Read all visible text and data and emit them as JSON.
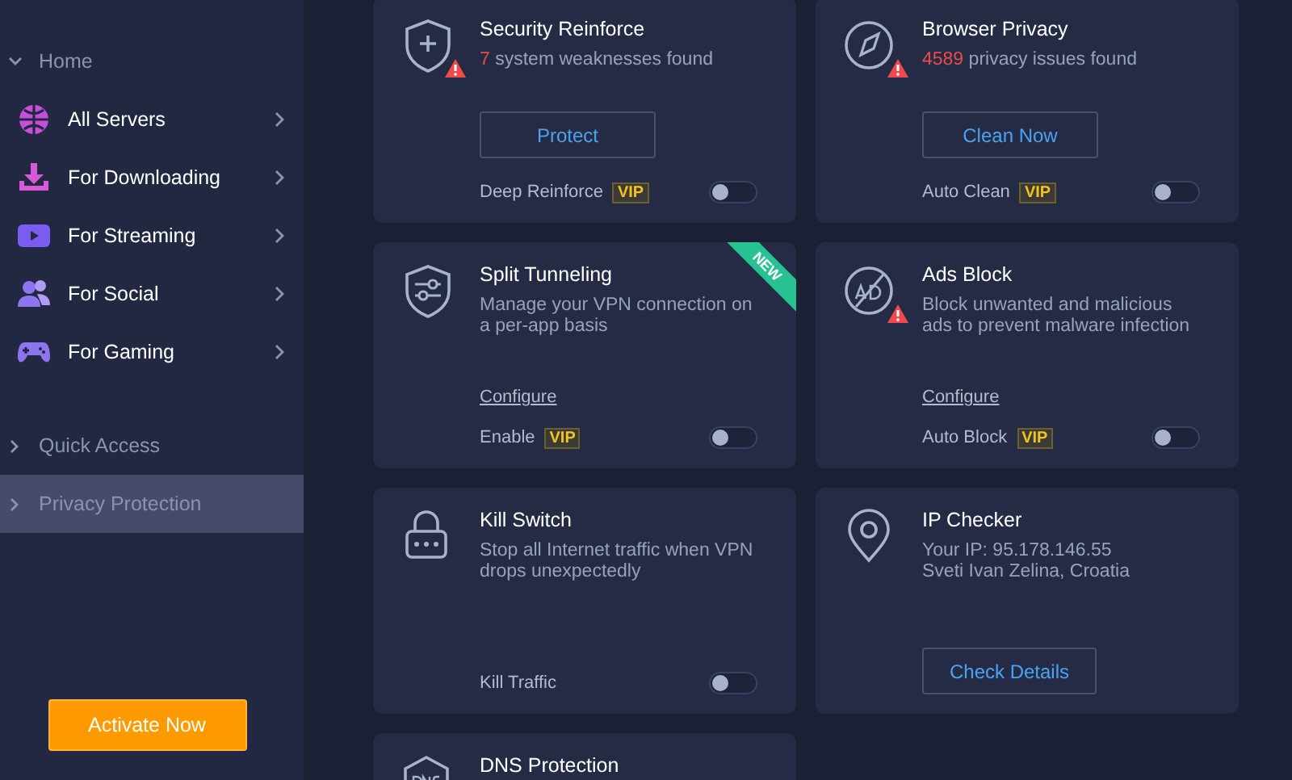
{
  "sidebar": {
    "sections": [
      {
        "label": "Home",
        "expanded": true,
        "selected": false,
        "items": [
          {
            "label": "All Servers"
          },
          {
            "label": "For Downloading"
          },
          {
            "label": "For Streaming"
          },
          {
            "label": "For Social"
          },
          {
            "label": "For Gaming"
          }
        ]
      },
      {
        "label": "Quick Access",
        "expanded": false,
        "selected": false
      },
      {
        "label": "Privacy Protection",
        "expanded": false,
        "selected": true
      }
    ],
    "activate_button": "Activate Now"
  },
  "cards": [
    {
      "kind": "action",
      "alert": true,
      "title": "Security Reinforce",
      "count": "7",
      "text": "system weaknesses found",
      "button": "Protect",
      "toggle": {
        "label": "Deep Reinforce",
        "badge": "VIP",
        "on": false
      }
    },
    {
      "kind": "action",
      "alert": true,
      "title": "Browser Privacy",
      "count": "4589",
      "text": "privacy issues found",
      "button": "Clean Now",
      "toggle": {
        "label": "Auto Clean",
        "badge": "VIP",
        "on": false
      }
    },
    {
      "kind": "config",
      "alert": false,
      "ribbon": "NEW",
      "title": "Split Tunneling",
      "description": "Manage your VPN connection on a per-app basis",
      "link": "Configure",
      "toggle": {
        "label": "Enable",
        "badge": "VIP",
        "on": false
      }
    },
    {
      "kind": "config",
      "alert": true,
      "title": "Ads Block",
      "description": "Block unwanted and malicious ads to prevent malware infection",
      "link": "Configure",
      "toggle": {
        "label": "Auto Block",
        "badge": "VIP",
        "on": false
      }
    },
    {
      "kind": "toggle",
      "alert": false,
      "title": "Kill Switch",
      "description": "Stop all Internet traffic when VPN drops unexpectedly",
      "toggle": {
        "label": "Kill Traffic",
        "on": false
      }
    },
    {
      "kind": "info",
      "alert": false,
      "title": "IP Checker",
      "lines": [
        "Your IP: 95.178.146.55",
        "Sveti Ivan Zelina, Croatia"
      ],
      "button": "Check Details"
    },
    {
      "kind": "title",
      "title": "DNS Protection"
    }
  ]
}
